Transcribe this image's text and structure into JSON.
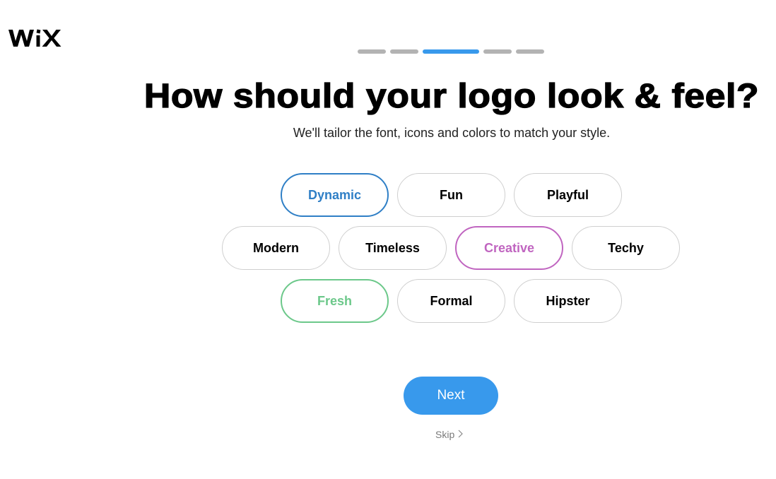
{
  "brand": {
    "logo_text": "WiX"
  },
  "progress": {
    "total_steps": 5,
    "current_step": 3,
    "active_color": "#3899ec",
    "inactive_color": "#b3b3b3"
  },
  "header": {
    "title": "How should your logo look & feel?",
    "subtitle": "We'll tailor the font, icons and colors to match your style."
  },
  "styles": {
    "options": [
      {
        "label": "Dynamic",
        "selected": true,
        "color": "#2f7fc6"
      },
      {
        "label": "Fun",
        "selected": false,
        "color": "#000000"
      },
      {
        "label": "Playful",
        "selected": false,
        "color": "#000000"
      },
      {
        "label": "Modern",
        "selected": false,
        "color": "#000000"
      },
      {
        "label": "Timeless",
        "selected": false,
        "color": "#000000"
      },
      {
        "label": "Creative",
        "selected": true,
        "color": "#c065c0"
      },
      {
        "label": "Techy",
        "selected": false,
        "color": "#000000"
      },
      {
        "label": "Fresh",
        "selected": true,
        "color": "#6cc88a"
      },
      {
        "label": "Formal",
        "selected": false,
        "color": "#000000"
      },
      {
        "label": "Hipster",
        "selected": false,
        "color": "#000000"
      }
    ]
  },
  "actions": {
    "next_label": "Next",
    "skip_label": "Skip",
    "skip_icon": "chevron-right-icon",
    "accent": "#3899ec"
  }
}
